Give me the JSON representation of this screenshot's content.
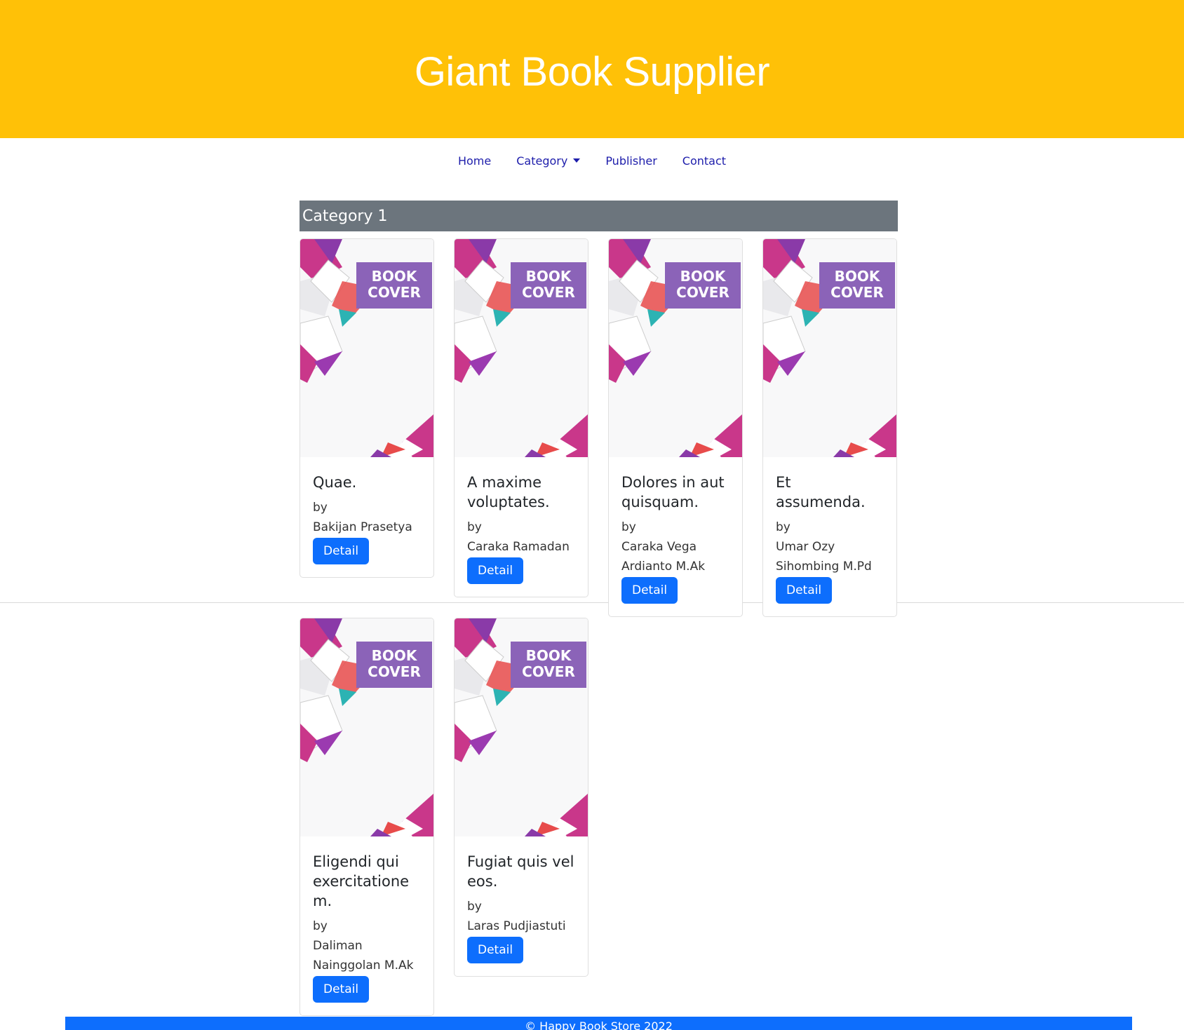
{
  "site": {
    "title": "Giant Book Supplier"
  },
  "nav": {
    "home": "Home",
    "category": "Category",
    "publisher": "Publisher",
    "contact": "Contact"
  },
  "category": {
    "title": "Category 1"
  },
  "cover_text": {
    "line1": "BOOK",
    "line2": "COVER"
  },
  "books": [
    {
      "title": "Quae.",
      "by": "by",
      "author": "Bakijan Prasetya",
      "button": "Detail"
    },
    {
      "title": "A maxime voluptates.",
      "by": "by",
      "author": "Caraka Ramadan",
      "button": "Detail"
    },
    {
      "title": "Dolores in aut quisquam.",
      "by": "by",
      "author": "Caraka Vega Ardianto M.Ak",
      "button": "Detail"
    },
    {
      "title": "Et assumenda.",
      "by": "by",
      "author": "Umar Ozy Sihombing M.Pd",
      "button": "Detail"
    },
    {
      "title": "Eligendi qui exercitationem.",
      "by": "by",
      "author": "Daliman Nainggolan M.Ak",
      "button": "Detail"
    },
    {
      "title": "Fugiat quis vel eos.",
      "by": "by",
      "author": "Laras Pudjiastuti",
      "button": "Detail"
    }
  ],
  "footer": {
    "text": "© Happy Book Store 2022"
  }
}
